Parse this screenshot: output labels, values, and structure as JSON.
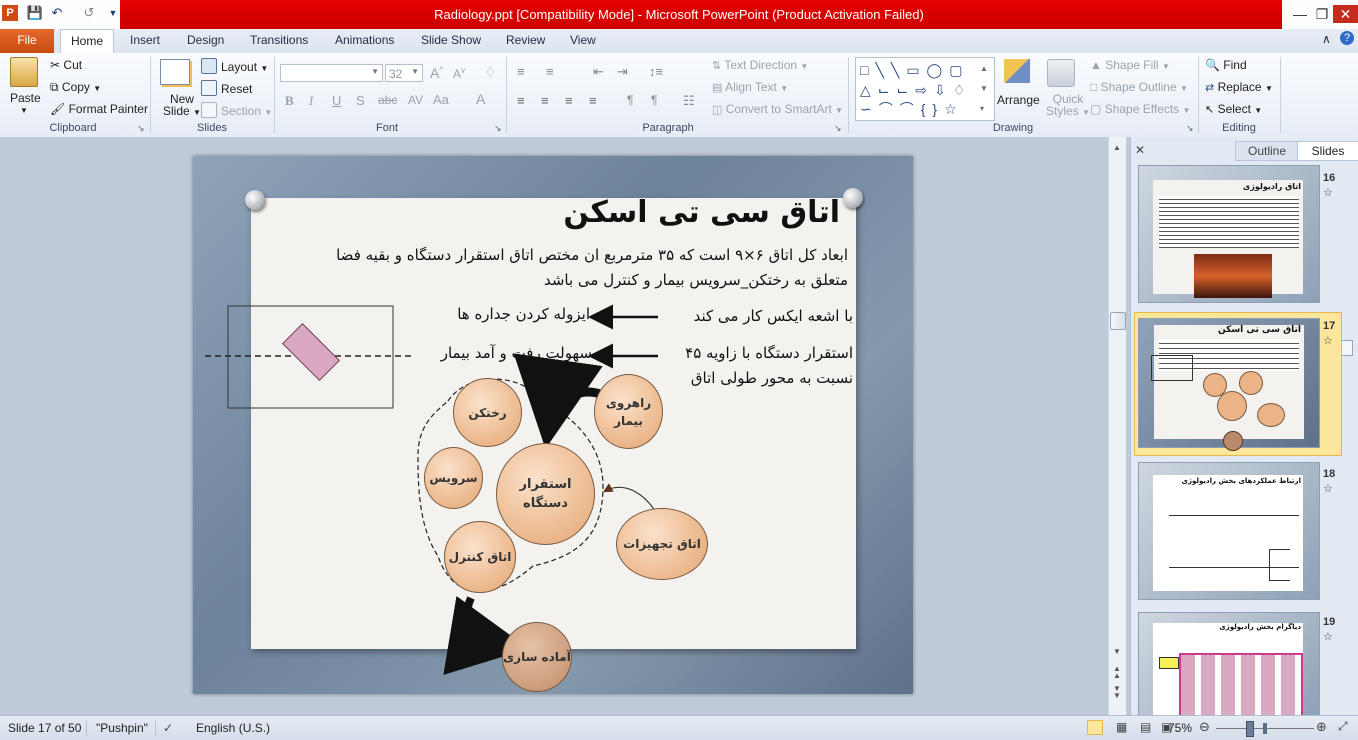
{
  "window": {
    "title": "Radiology.ppt [Compatibility Mode]  -  Microsoft PowerPoint (Product Activation Failed)"
  },
  "tabs": [
    "File",
    "Home",
    "Insert",
    "Design",
    "Transitions",
    "Animations",
    "Slide Show",
    "Review",
    "View"
  ],
  "ribbon": {
    "clipboard": {
      "paste": "Paste",
      "cut": "Cut",
      "copy": "Copy",
      "format_painter": "Format Painter",
      "label": "Clipboard"
    },
    "slides": {
      "new_slide_1": "New",
      "new_slide_2": "Slide",
      "layout": "Layout",
      "reset": "Reset",
      "section": "Section",
      "label": "Slides"
    },
    "font": {
      "size": "32",
      "label": "Font"
    },
    "paragraph": {
      "text_direction": "Text Direction",
      "align_text": "Align Text",
      "convert": "Convert to SmartArt",
      "label": "Paragraph"
    },
    "drawing": {
      "arrange": "Arrange",
      "quick_1": "Quick",
      "quick_2": "Styles",
      "shape_fill": "Shape Fill",
      "shape_outline": "Shape Outline",
      "shape_effects": "Shape Effects",
      "label": "Drawing"
    },
    "editing": {
      "find": "Find",
      "replace": "Replace",
      "select": "Select",
      "label": "Editing"
    }
  },
  "slide": {
    "title": "اتاق سی تی اسکن",
    "line1": "ابعاد کل اتاق ۶×۹ است که ۳۵ مترمربع ان مختص اتاق استقرار دستگاه و بقیه فضا",
    "line2": "متعلق به رختکن_سرویس بیمار و کنترل می باشد",
    "line3_right": "با اشعه ایکس کار می کند",
    "line3_left": "ایزوله کردن جداره ها",
    "line4_right": "استقرار دستگاه با زاویه ۴۵",
    "line4_left": "سهولت رفت و آمد بیمار",
    "line5": "نسبت به محور طولی اتاق",
    "circles": {
      "dressing": "رختکن",
      "corridor": "راهروی بیمار",
      "service": "سرویس",
      "device": "استقرار دستگاه",
      "control": "اتاق کنترل",
      "equipment": "اتاق تجهیزات",
      "prep": "آماده سازی"
    }
  },
  "panel": {
    "tab_outline": "Outline",
    "tab_slides": "Slides",
    "thumbs": [
      {
        "num": "16",
        "title": "اتاق رادیولوژی"
      },
      {
        "num": "17",
        "title": "اتاق سی تی اسکن"
      },
      {
        "num": "18",
        "title": "ارتباط عملکردهای بخش رادیولوژی"
      },
      {
        "num": "19",
        "title": "دیاگرام بخش رادیولوژی"
      }
    ]
  },
  "status": {
    "slide": "Slide 17 of 50",
    "theme": "\"Pushpin\"",
    "language": "English (U.S.)",
    "zoom": "75%"
  }
}
